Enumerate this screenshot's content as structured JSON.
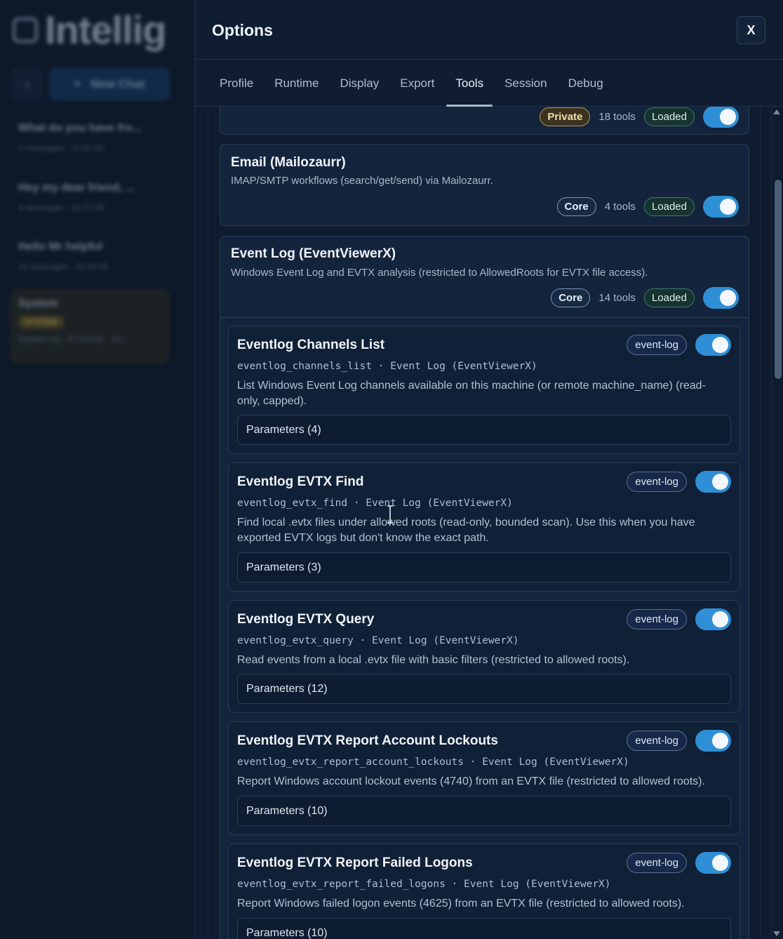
{
  "background": {
    "brand": "Intellig",
    "new_chat": "New Chat",
    "chats": [
      {
        "title": "What do you have fro...",
        "sub": "4 messages · 15:42:50"
      },
      {
        "title": "Hey my dear friend, ...",
        "sub": "4 messages · 15:37:29"
      },
      {
        "title": "Hello Mr helpful",
        "sub": "10 messages · 15:04:40"
      },
      {
        "title": "System",
        "badge": "SYSTEM",
        "sub": "System log · 27 events · 14..."
      }
    ]
  },
  "modal": {
    "title": "Options",
    "close_label": "X",
    "tabs": [
      "Profile",
      "Runtime",
      "Display",
      "Export",
      "Tools",
      "Session",
      "Debug"
    ],
    "active_tab": "Tools"
  },
  "packs": [
    {
      "name": "",
      "desc": "",
      "badge": "Private",
      "tools": "18 tools",
      "status": "Loaded",
      "enabled": true
    },
    {
      "name": "Email (Mailozaurr)",
      "desc": "IMAP/SMTP workflows (search/get/send) via Mailozaurr.",
      "badge": "Core",
      "tools": "4 tools",
      "status": "Loaded",
      "enabled": true
    },
    {
      "name": "Event Log (EventViewerX)",
      "desc": "Windows Event Log and EVTX analysis (restricted to AllowedRoots for EVTX file access).",
      "badge": "Core",
      "tools": "14 tools",
      "status": "Loaded",
      "enabled": true
    }
  ],
  "tools": [
    {
      "name": "Eventlog Channels List",
      "id": "eventlog_channels_list · Event Log (EventViewerX)",
      "desc": "List Windows Event Log channels available on this machine (or remote machine_name) (read-only, capped).",
      "tag": "event-log",
      "params": "Parameters (4)",
      "enabled": true
    },
    {
      "name": "Eventlog EVTX Find",
      "id": "eventlog_evtx_find · Event Log (EventViewerX)",
      "desc": "Find local .evtx files under allowed roots (read-only, bounded scan). Use this when you have exported EVTX logs but don't know the exact path.",
      "tag": "event-log",
      "params": "Parameters (3)",
      "enabled": true
    },
    {
      "name": "Eventlog EVTX Query",
      "id": "eventlog_evtx_query · Event Log (EventViewerX)",
      "desc": "Read events from a local .evtx file with basic filters (restricted to allowed roots).",
      "tag": "event-log",
      "params": "Parameters (12)",
      "enabled": true
    },
    {
      "name": "Eventlog EVTX Report Account Lockouts",
      "id": "eventlog_evtx_report_account_lockouts · Event Log (EventViewerX)",
      "desc": "Report Windows account lockout events (4740) from an EVTX file (restricted to allowed roots).",
      "tag": "event-log",
      "params": "Parameters (10)",
      "enabled": true
    },
    {
      "name": "Eventlog EVTX Report Failed Logons",
      "id": "eventlog_evtx_report_failed_logons · Event Log (EventViewerX)",
      "desc": "Report Windows failed logon events (4625) from an EVTX file (restricted to allowed roots).",
      "tag": "event-log",
      "params": "Parameters (10)",
      "enabled": true
    }
  ]
}
